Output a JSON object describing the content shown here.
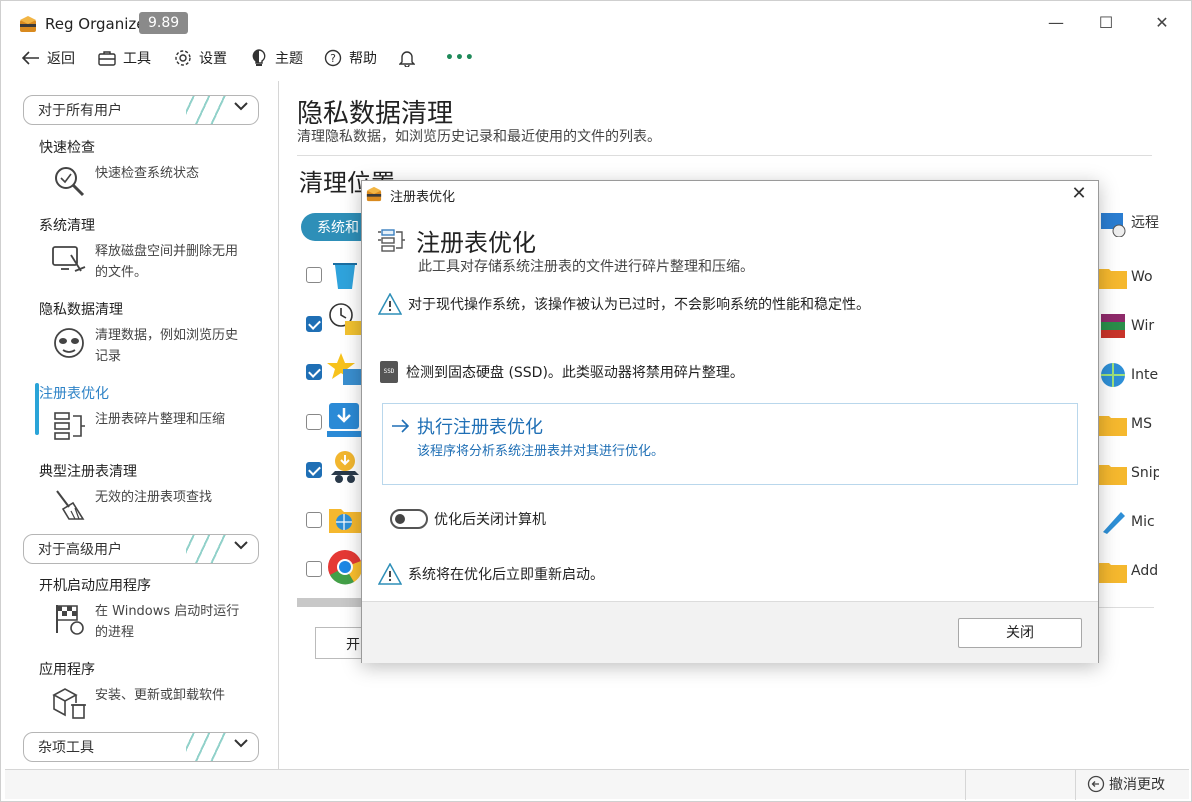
{
  "app": {
    "title": "Reg Organizer",
    "version": "9.89"
  },
  "window_controls": {
    "minimize": "—",
    "maximize": "☐",
    "close": "✕"
  },
  "toolbar": {
    "back": "返回",
    "tools": "工具",
    "settings": "设置",
    "theme": "主题",
    "help": "帮助",
    "more": "•••"
  },
  "sidebar": {
    "group_all_users": "对于所有用户",
    "group_advanced": "对于高级用户",
    "group_misc": "杂项工具",
    "items": [
      {
        "label": "快速检查",
        "desc": "快速检查系统状态",
        "icon": "magnifier-icon"
      },
      {
        "label": "系统清理",
        "desc": "释放磁盘空间并删除无用的文件。",
        "icon": "broom-computer-icon"
      },
      {
        "label": "隐私数据清理",
        "desc": "清理数据，例如浏览历史记录",
        "icon": "privacy-mask-icon"
      },
      {
        "label": "注册表优化",
        "desc": "注册表碎片整理和压缩",
        "icon": "registry-icon"
      },
      {
        "label": "典型注册表清理",
        "desc": "无效的注册表项查找",
        "icon": "registry-broom-icon"
      },
      {
        "label": "开机启动应用程序",
        "desc": "在 Windows 启动时运行的进程",
        "icon": "startup-flag-icon"
      },
      {
        "label": "应用程序",
        "desc": "安装、更新或卸载软件",
        "icon": "box-trash-icon"
      }
    ]
  },
  "main": {
    "title": "隐私数据清理",
    "subtitle": "清理隐私数据，如浏览历史记录和最近使用的文件的列表。",
    "section_title": "清理位置",
    "tab_system": "系统和",
    "start_button": "开",
    "right_items": [
      "远程",
      "Wo",
      "Wir",
      "Inte",
      "MS",
      "Snip",
      "Mic",
      "Add"
    ],
    "rows": [
      {
        "checked": false
      },
      {
        "checked": true
      },
      {
        "checked": true
      },
      {
        "checked": false
      },
      {
        "checked": true
      },
      {
        "checked": false
      },
      {
        "checked": false
      }
    ]
  },
  "statusbar": {
    "undo": "撤消更改"
  },
  "dialog": {
    "window_title": "注册表优化",
    "heading": "注册表优化",
    "description": "此工具对存储系统注册表的文件进行碎片整理和压缩。",
    "warning_outdated": "对于现代操作系统，该操作被认为已过时，不会影响系统的性能和稳定性。",
    "ssd_notice": "检测到固态硬盘 (SSD)。此类驱动器将禁用碎片整理。",
    "ssd_icon_text": "SSD",
    "action_title": "执行注册表优化",
    "action_desc": "该程序将分析系统注册表并对其进行优化。",
    "toggle_label": "优化后关闭计算机",
    "toggle_on": false,
    "restart_notice": "系统将在优化后立即重新启动。",
    "close_button": "关闭"
  },
  "colors": {
    "accent": "#2e83c7",
    "active_bar": "#2aa4d8",
    "action": "#1f6fb5",
    "badge": "#8a8a8a"
  }
}
